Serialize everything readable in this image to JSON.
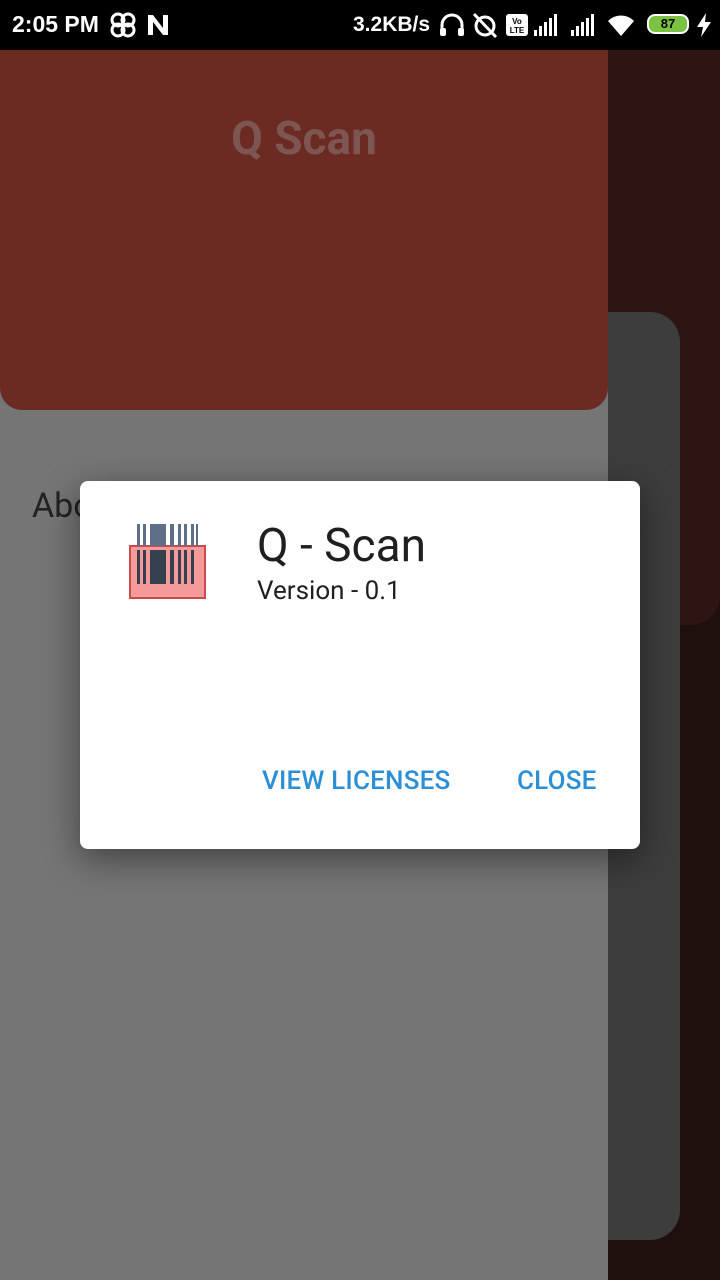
{
  "status_bar": {
    "time": "2:05 PM",
    "net_speed": "3.2KB/s",
    "battery": "87",
    "icons": [
      "fan-icon",
      "n-icon",
      "headset-icon",
      "alarm-off-icon",
      "volte-icon",
      "signal-icon",
      "signal-icon",
      "wifi-icon",
      "battery-icon",
      "charging-icon"
    ]
  },
  "background": {
    "hero_title": "Q Scan",
    "about_label": "About"
  },
  "dialog": {
    "title": "Q - Scan",
    "version": "Version - 0.1",
    "view_licenses_label": "VIEW LICENSES",
    "close_label": "CLOSE",
    "app_icon": "barcode-icon"
  },
  "colors": {
    "accent": "#2b8fd6",
    "hero": "#6b2a22",
    "scrim_card": "#757575"
  }
}
